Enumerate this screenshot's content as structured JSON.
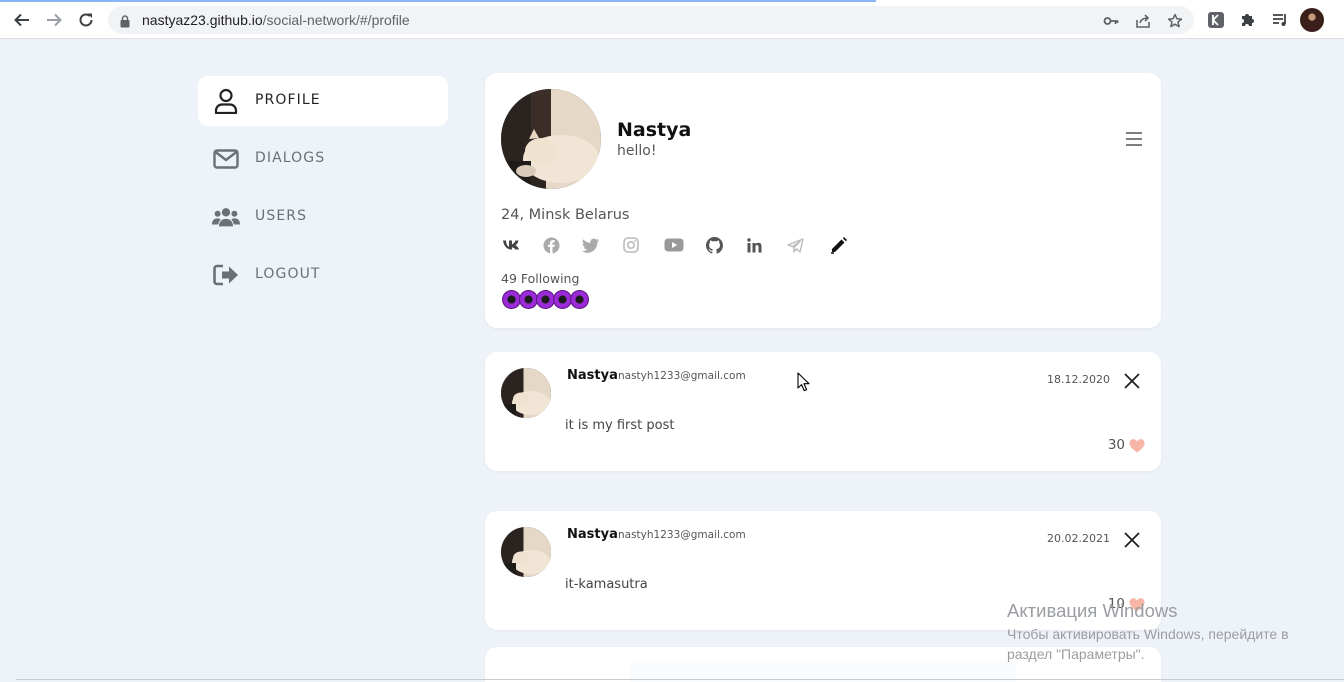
{
  "browser": {
    "url_host": "nastyaz23.github.io",
    "url_path": "/social-network/#/profile"
  },
  "sidebar": {
    "items": [
      {
        "label": "PROFILE",
        "icon": "user-icon",
        "active": true
      },
      {
        "label": "DIALOGS",
        "icon": "envelope-icon",
        "active": false
      },
      {
        "label": "USERS",
        "icon": "users-icon",
        "active": false
      },
      {
        "label": "LOGOUT",
        "icon": "logout-icon",
        "active": false
      }
    ]
  },
  "profile": {
    "name": "Nastya",
    "status": "hello!",
    "location": "24, Minsk Belarus",
    "following": "49 Following",
    "socials": [
      "vk-icon",
      "facebook-icon",
      "twitter-icon",
      "instagram-icon",
      "youtube-icon",
      "github-icon",
      "linkedin-icon",
      "telegram-icon",
      "edit-pencil-icon"
    ],
    "following_avatars_count": 5
  },
  "posts": [
    {
      "author": "Nastya",
      "email": "nastyh1233@gmail.com",
      "date": "18.12.2020",
      "text": "it is my first post",
      "likes": "30"
    },
    {
      "author": "Nastya",
      "email": "nastyh1233@gmail.com",
      "date": "20.02.2021",
      "text": "it-kamasutra",
      "likes": "10"
    }
  ],
  "overlay": {
    "windows_title": "Активация Windows",
    "windows_line1": "Чтобы активировать Windows, перейдите в",
    "windows_line2": "раздел \"Параметры\"."
  },
  "colors": {
    "accent_heart": "#f7b6a6",
    "background": "#eef3f9",
    "following_avatar": "#9b2bd9"
  }
}
